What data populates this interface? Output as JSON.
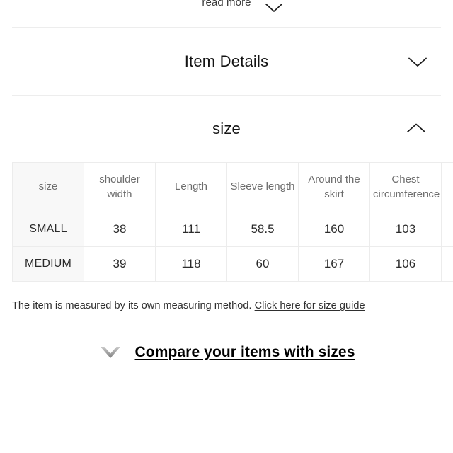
{
  "sections": {
    "read_more": {
      "label": "read more",
      "icon": "chevron-down-icon",
      "expanded": false
    },
    "item_details": {
      "label": "Item Details",
      "icon": "chevron-down-icon",
      "expanded": false
    },
    "size": {
      "label": "size",
      "icon": "chevron-up-icon",
      "expanded": true
    }
  },
  "size_table": {
    "headers": [
      "size",
      "shoulder width",
      "Length",
      "Sleeve length",
      "Around the skirt",
      "Chest circumference",
      ""
    ],
    "rows": [
      {
        "size": "SMALL",
        "shoulder_width": "38",
        "length": "111",
        "sleeve_length": "58.5",
        "around_the_skirt": "160",
        "chest_circumference": "103",
        "extra": ""
      },
      {
        "size": "MEDIUM",
        "shoulder_width": "39",
        "length": "118",
        "sleeve_length": "60",
        "around_the_skirt": "167",
        "chest_circumference": "106",
        "extra": ""
      }
    ]
  },
  "note": {
    "text": "The item is measured by its own measuring method.",
    "link_label": "Click here for size guide"
  },
  "compare": {
    "icon": "chevron-down-filled-icon",
    "label": "Compare your items with sizes"
  },
  "colors": {
    "text_primary": "#1c1c1c",
    "text_secondary": "#6d6d6d",
    "divider": "#ededed",
    "table_border": "#ececec",
    "cell_tint": "#f8f8f8",
    "chevron_gray": "#9b9b9b"
  }
}
